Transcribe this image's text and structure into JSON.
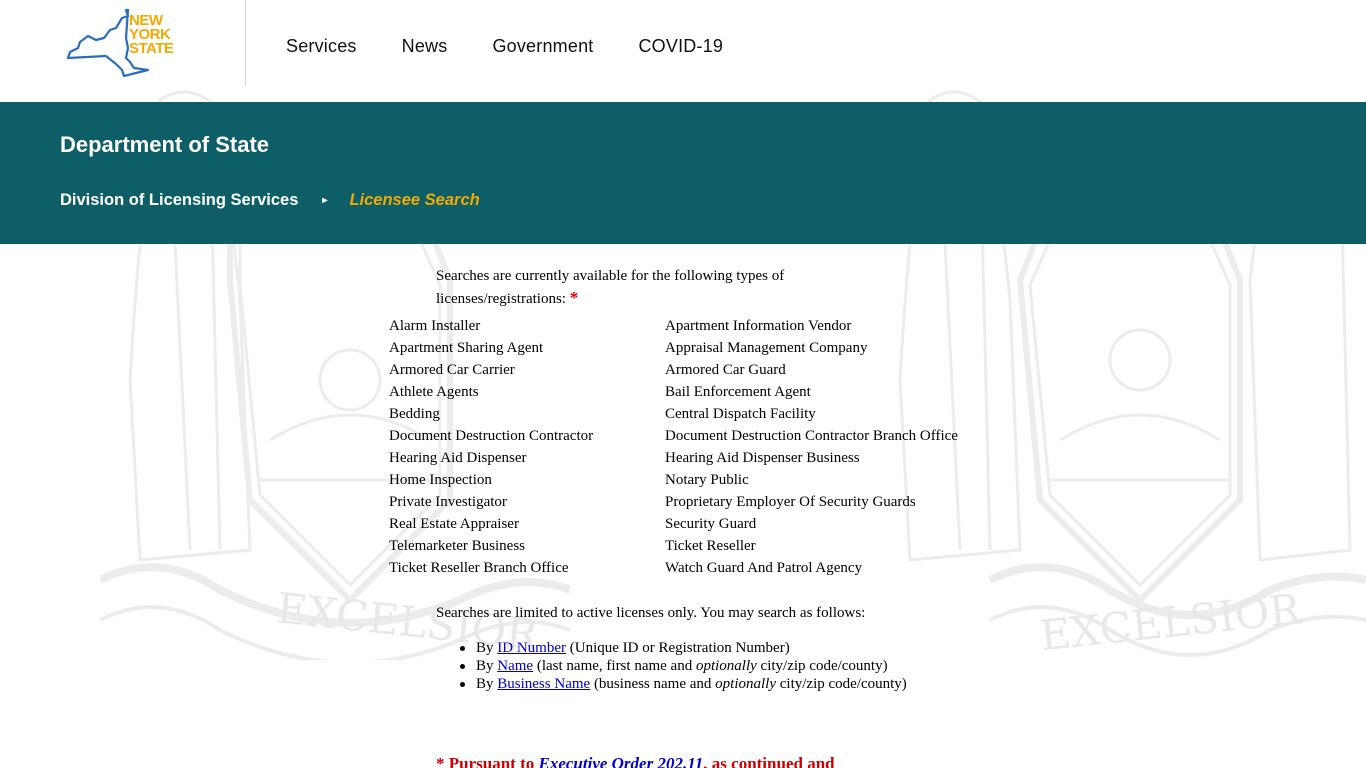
{
  "header": {
    "logo": {
      "line1": "NEW",
      "line2": "YORK",
      "line3": "STATE"
    },
    "nav": [
      {
        "label": "Services"
      },
      {
        "label": "News"
      },
      {
        "label": "Government"
      },
      {
        "label": "COVID-19"
      }
    ]
  },
  "banner": {
    "title": "Department of State",
    "breadcrumb": {
      "parent": "Division of Licensing Services",
      "separator": "▸",
      "current": "Licensee Search"
    },
    "colors": {
      "background": "#0d5e66",
      "accent": "#f2a900"
    }
  },
  "content": {
    "intro_text": "Searches are currently available for the following types of licenses/registrations:",
    "intro_star": "*",
    "license_types_left": [
      "Alarm Installer",
      "Apartment Sharing Agent",
      "Armored Car Carrier",
      "Athlete Agents",
      "Bedding",
      "Document Destruction Contractor",
      "Hearing Aid Dispenser",
      "Home Inspection",
      "Private Investigator",
      "Real Estate Appraiser",
      "Telemarketer Business",
      "Ticket Reseller Branch Office"
    ],
    "license_types_right": [
      "Apartment Information Vendor",
      "Appraisal Management Company",
      "Armored Car Guard",
      "Bail Enforcement Agent",
      "Central Dispatch Facility",
      "Document Destruction Contractor Branch Office",
      "Hearing Aid Dispenser Business",
      "Notary Public",
      "Proprietary Employer Of Security Guards",
      "Security Guard",
      "Ticket Reseller",
      "Watch Guard And Patrol Agency"
    ],
    "limits_text": "Searches are limited to active licenses only. You may search as follows:",
    "search_methods": [
      {
        "prefix": "By ",
        "link": "ID Number",
        "desc": " (Unique ID or Registration Number)",
        "desc_italic": "",
        "desc_tail": ""
      },
      {
        "prefix": "By ",
        "link": "Name",
        "desc": " (last name, first name and ",
        "desc_italic": "optionally",
        "desc_tail": " city/zip code/county)"
      },
      {
        "prefix": "By ",
        "link": "Business Name",
        "desc": " (business name and ",
        "desc_italic": "optionally",
        "desc_tail": " city/zip code/county)"
      }
    ],
    "footnote": {
      "prefix": "* Pursuant to ",
      "link": "Executive Order 202.11",
      "suffix": ", as continued and"
    },
    "watermark_motto": "EXCELSIOR"
  }
}
